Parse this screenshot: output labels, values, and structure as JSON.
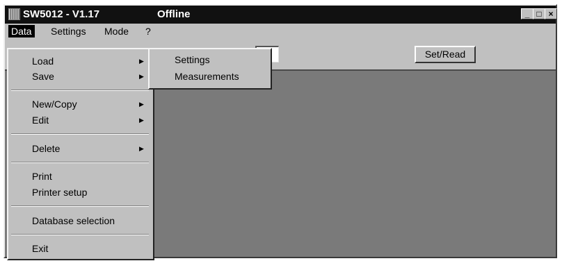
{
  "window": {
    "title": "SW5012 - V1.17",
    "status": "Offline",
    "controls": {
      "minimize": "_",
      "maximize": "□",
      "close": "×"
    }
  },
  "menubar": {
    "items": [
      "Data",
      "Settings",
      "Mode",
      "?"
    ]
  },
  "toolbar": {
    "set_read_label": "Set/Read"
  },
  "data_menu": {
    "load": "Load",
    "save": "Save",
    "new_copy": "New/Copy",
    "edit": "Edit",
    "delete": "Delete",
    "print": "Print",
    "printer_setup": "Printer setup",
    "database_selection": "Database selection",
    "exit": "Exit",
    "arrow": "▶"
  },
  "load_submenu": {
    "items": [
      "Settings",
      "Measurements"
    ]
  }
}
